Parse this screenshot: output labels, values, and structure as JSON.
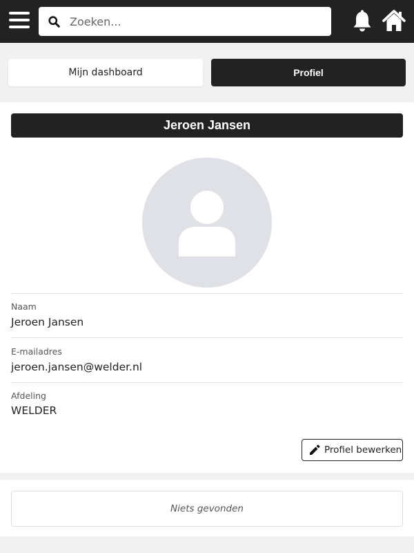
{
  "header": {
    "search": {
      "placeholder": "Zoeken...",
      "value": ""
    },
    "icons": {
      "menu": "hamburger-menu-icon",
      "search": "search-icon",
      "notifications": "bell-icon",
      "home": "home-icon"
    }
  },
  "tabs": [
    {
      "label": "Mijn dashboard",
      "active": false
    },
    {
      "label": "Profiel",
      "active": true
    }
  ],
  "profile": {
    "name": "Jeroen Jansen",
    "avatar_icon": "user-placeholder-icon",
    "fields": [
      {
        "label": "Naam",
        "value": "Jeroen Jansen"
      },
      {
        "label": "E-mailadres",
        "value": "jeroen.jansen@welder.nl"
      },
      {
        "label": "Afdeling",
        "value": "WELDER"
      }
    ],
    "edit_button": {
      "label": "Profiel bewerken",
      "icon": "pencil-icon"
    }
  },
  "results": {
    "empty_text": "Niets gevonden"
  },
  "colors": {
    "dark": "#222222",
    "avatar_bg": "#dfe1e6",
    "page_bg": "#f1f1f1"
  }
}
